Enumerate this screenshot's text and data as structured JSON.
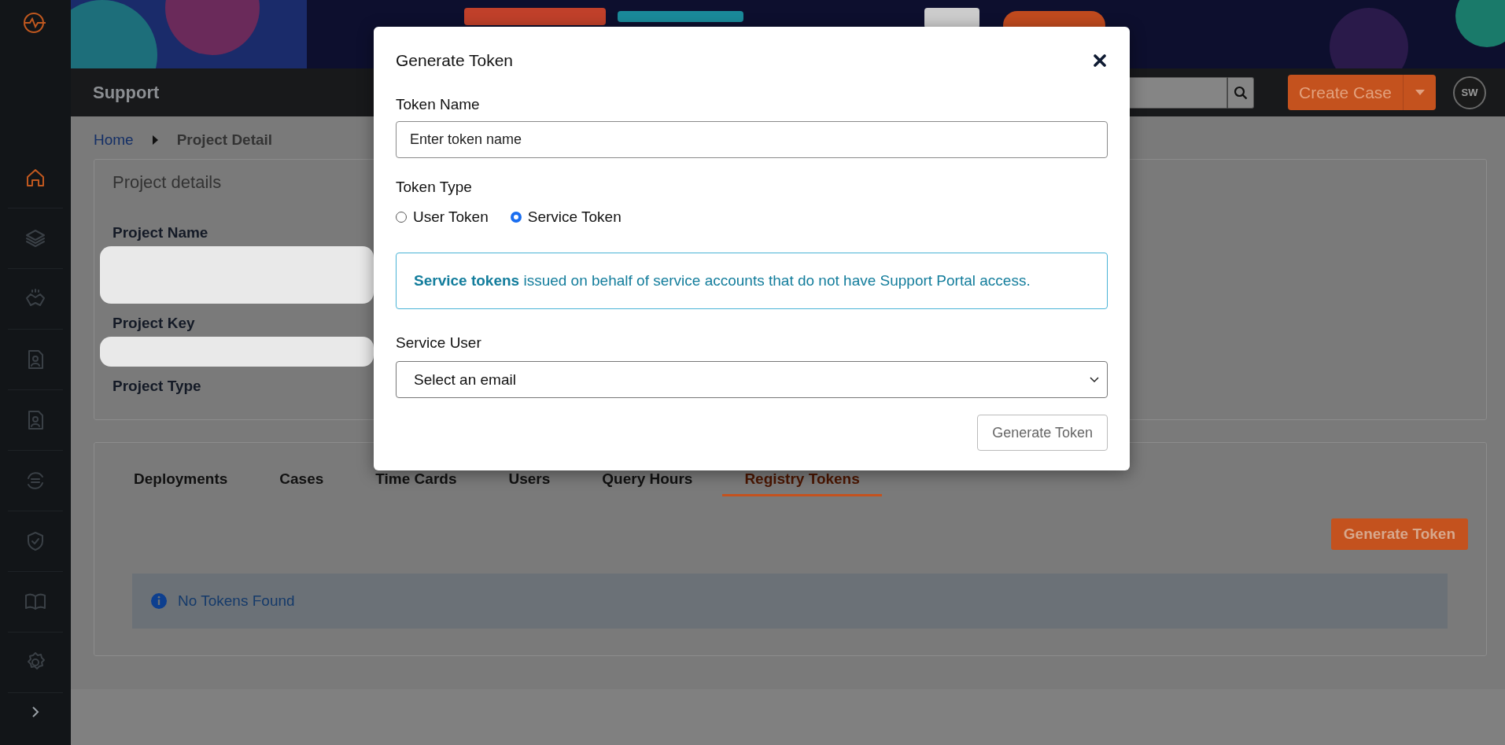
{
  "sidebar": {
    "items": [
      {
        "selected": true
      },
      {
        "selected": false
      },
      {
        "selected": false
      },
      {
        "selected": false
      },
      {
        "selected": false
      },
      {
        "selected": false
      },
      {
        "selected": false
      },
      {
        "selected": false
      },
      {
        "selected": false
      }
    ]
  },
  "banner": {
    "kind": "picture"
  },
  "header": {
    "title": "Support",
    "create_button": "Create Case",
    "avatar": "SW"
  },
  "breadcrumb": [
    "Home",
    "Project Detail"
  ],
  "project_details": {
    "title": "Project details",
    "fields": [
      {
        "label": "Project Name",
        "redacted": true
      },
      {
        "label": "Project Key",
        "redacted": true
      },
      {
        "label": "Project Type",
        "redacted": false
      }
    ]
  },
  "tabs": [
    {
      "label": "Deployments",
      "selected": false
    },
    {
      "label": "Cases",
      "selected": false
    },
    {
      "label": "Time Cards",
      "selected": false
    },
    {
      "label": "Users",
      "selected": false
    },
    {
      "label": "Query Hours",
      "selected": false
    },
    {
      "label": "Registry Tokens",
      "selected": true
    }
  ],
  "generate_button": "Generate Token",
  "alert": "No Tokens Found",
  "modal": {
    "title": "Generate Token",
    "token_name_label": "Token Name",
    "token_name_placeholder": "Enter token name",
    "token_type_label": "Token Type",
    "token_types": [
      {
        "label": "User Token",
        "selected": false
      },
      {
        "label": "Service Token",
        "selected": true
      }
    ],
    "info": "**Service tokens** issued on behalf of service accounts that do not have Support Portal access.",
    "service_user_label": "Service User",
    "service_user_placeholder": "Select an email",
    "submit": "Generate Token"
  }
}
